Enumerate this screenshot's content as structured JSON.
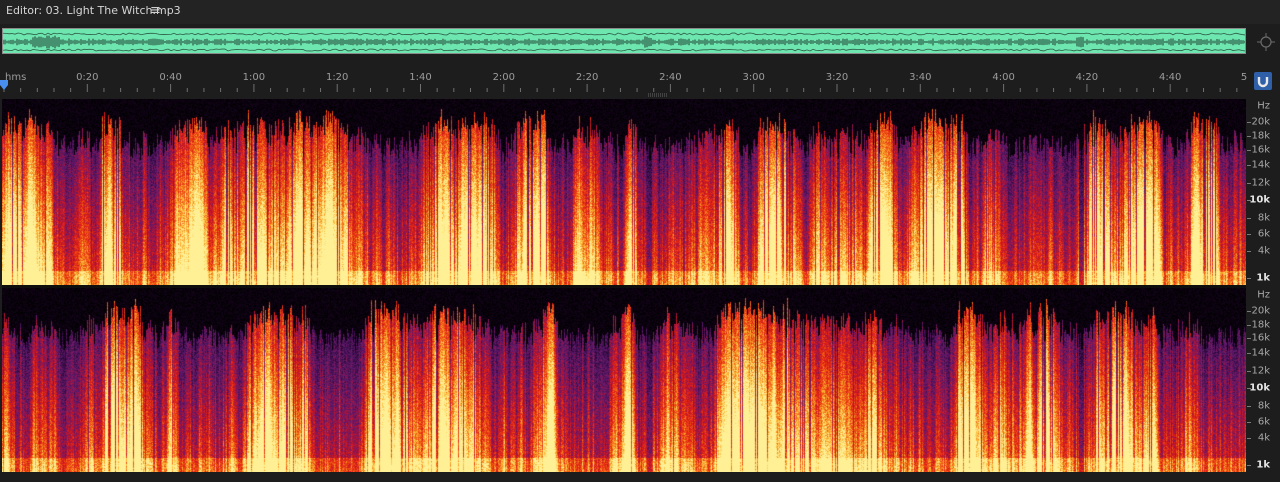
{
  "editor": {
    "title": "Editor: 03. Light The Witch.mp3",
    "menu_icon": "hamburger-menu-icon",
    "zoom_nav_icon": "zoom-navigator-icon",
    "snap_icon": "snap-magnet-icon"
  },
  "ruler": {
    "unit_label": "hms",
    "ticks": [
      "0:20",
      "0:40",
      "1:00",
      "1:20",
      "1:40",
      "2:00",
      "2:20",
      "2:40",
      "3:00",
      "3:20",
      "3:40",
      "4:00",
      "4:20",
      "4:40",
      "5"
    ]
  },
  "spectral_channels": [
    {
      "unit": "Hz",
      "labels": [
        {
          "text": "20k",
          "bold": false
        },
        {
          "text": "18k",
          "bold": false
        },
        {
          "text": "16k",
          "bold": false
        },
        {
          "text": "14k",
          "bold": false
        },
        {
          "text": "12k",
          "bold": false
        },
        {
          "text": "10k",
          "bold": true
        },
        {
          "text": "8k",
          "bold": false
        },
        {
          "text": "6k",
          "bold": false
        },
        {
          "text": "4k",
          "bold": false
        },
        {
          "text": "1k",
          "bold": true
        }
      ]
    },
    {
      "unit": "Hz",
      "labels": [
        {
          "text": "20k",
          "bold": false
        },
        {
          "text": "18k",
          "bold": false
        },
        {
          "text": "16k",
          "bold": false
        },
        {
          "text": "14k",
          "bold": false
        },
        {
          "text": "12k",
          "bold": false
        },
        {
          "text": "10k",
          "bold": true
        },
        {
          "text": "8k",
          "bold": false
        },
        {
          "text": "6k",
          "bold": false
        },
        {
          "text": "4k",
          "bold": false
        },
        {
          "text": "1k",
          "bold": true
        }
      ]
    }
  ],
  "colors": {
    "overview_waveform_bg": "#6ee6b0",
    "accent_blue": "#2e5fa8",
    "spectral_hot": "#ffe07a",
    "spectral_mid": "#e8231a",
    "spectral_cool": "#5a1a6e"
  }
}
